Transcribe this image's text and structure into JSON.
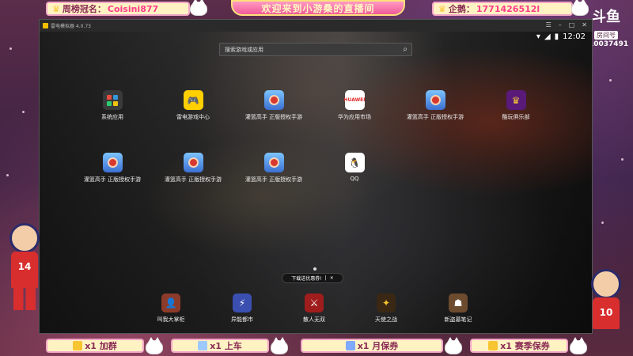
{
  "overlay": {
    "title": "欢迎来到小游桑的直播间",
    "rank_label": "周榜冠名：",
    "rank_name": "Coisini877",
    "wechat_label": "企鹅：",
    "wechat_value": "1771426512l",
    "platform_logo": "斗鱼",
    "platform_tag": "房间号",
    "room_number": "10037491",
    "buttons": [
      {
        "label": "x1 加群",
        "icon": "pencil-icon"
      },
      {
        "label": "x1 上车",
        "icon": "car-icon"
      },
      {
        "label": "x1 月保券",
        "icon": "ticket-icon"
      },
      {
        "label": "x1 赛季保券",
        "icon": "gift-icon"
      }
    ],
    "left_character_number": "14",
    "right_character_number": "10"
  },
  "emulator": {
    "title": "雷电模拟器 4.0.73",
    "time": "12:02",
    "search_placeholder": "搜索游戏或应用",
    "apps_row1": [
      {
        "label": "系统应用",
        "icon": "system-apps-icon"
      },
      {
        "label": "雷电游戏中心",
        "icon": "game-center-icon"
      },
      {
        "label": "灌篮高手 正版授权手游",
        "icon": "slam-dunk-icon"
      },
      {
        "label": "华为应用市场",
        "icon": "huawei-appstore-icon"
      },
      {
        "label": "灌篮高手 正版授权手游",
        "icon": "slam-dunk-icon"
      },
      {
        "label": "酷玩俱乐部",
        "icon": "crown-icon"
      }
    ],
    "apps_row2": [
      {
        "label": "灌篮高手 正版授权手游",
        "icon": "slam-dunk-icon"
      },
      {
        "label": "灌篮高手 正版授权手游",
        "icon": "slam-dunk-icon"
      },
      {
        "label": "灌篮高手 正版授权手游",
        "icon": "slam-dunk-icon"
      },
      {
        "label": "QQ",
        "icon": "qq-icon"
      }
    ],
    "huawei_text": "HUAWEI",
    "toast": "下载送优惠券!",
    "toast_close": "×",
    "dock": [
      {
        "label": "叫我大掌柜",
        "icon": "shopkeeper-icon"
      },
      {
        "label": "异能都市",
        "icon": "city-icon"
      },
      {
        "label": "散人无双",
        "icon": "warrior-icon"
      },
      {
        "label": "天使之战",
        "icon": "angel-icon"
      },
      {
        "label": "新盗墓笔记",
        "icon": "tomb-icon"
      }
    ]
  }
}
